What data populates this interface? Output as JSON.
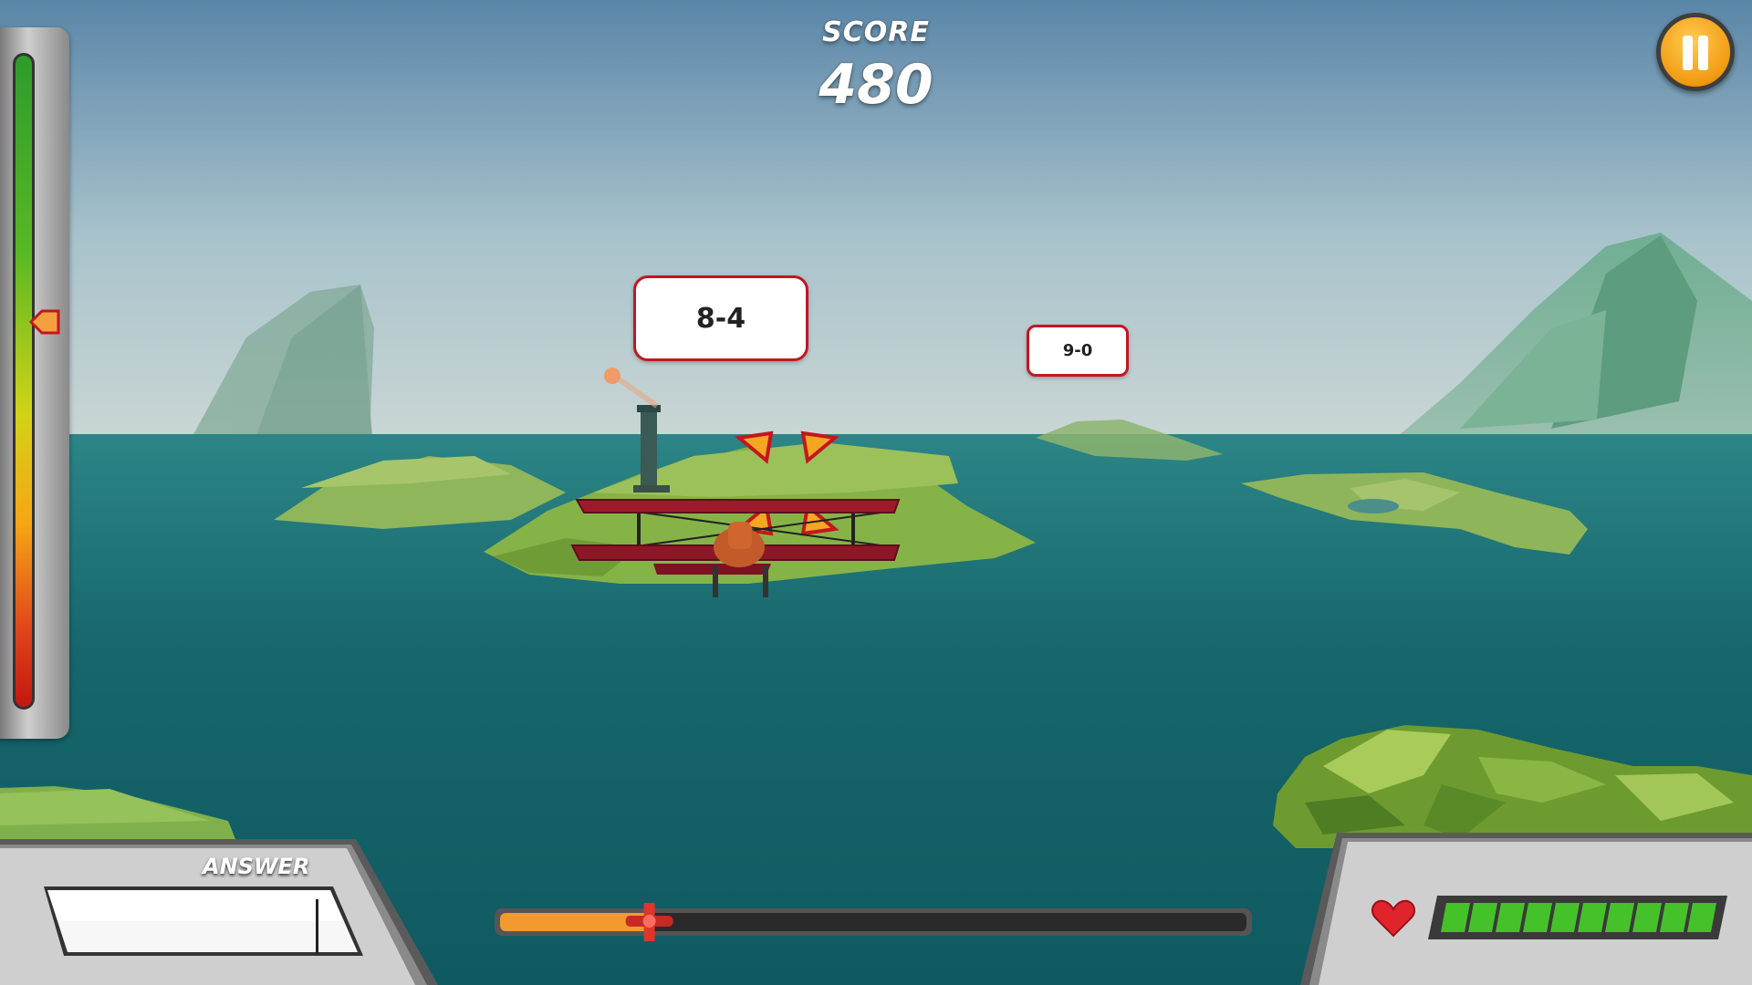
{
  "score": {
    "label": "SCORE",
    "value": "480"
  },
  "pause": {
    "icon": "pause-icon"
  },
  "altimeter": {
    "level": 0.41,
    "colors": {
      "top": "#2e9b2b",
      "bottom": "#c2160f"
    }
  },
  "problems": [
    {
      "expression": "8-4"
    },
    {
      "expression": "9-0"
    }
  ],
  "answer": {
    "label": "ANSWER",
    "value": ""
  },
  "progress": {
    "fraction": 0.2,
    "fill_color": "#f29a2e"
  },
  "health": {
    "segments_total": 10,
    "segments_filled": 10,
    "color": "#45c22a",
    "icon": "heart-icon"
  },
  "colors": {
    "accent": "#c3171f",
    "pause": "#f29a12",
    "sea": "#1d6a6e"
  }
}
